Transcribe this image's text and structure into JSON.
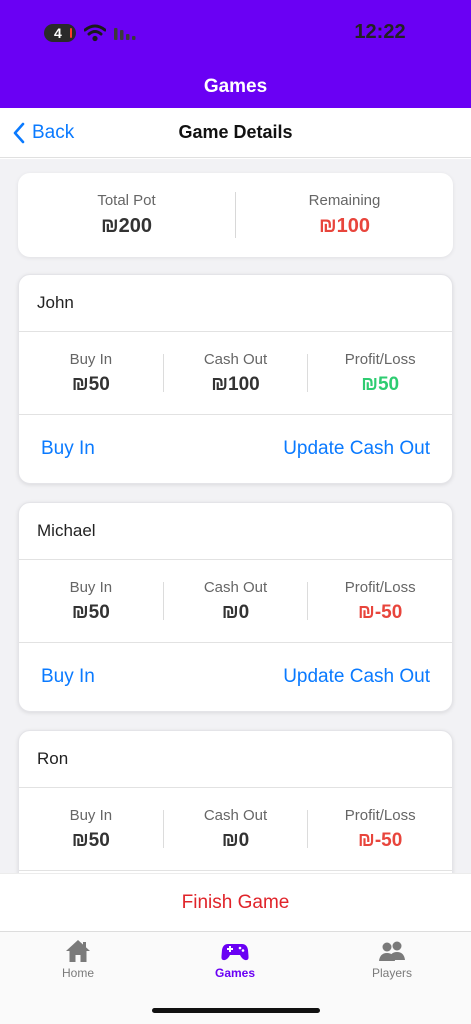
{
  "status_bar": {
    "badge": "4",
    "time": "12:22"
  },
  "header": {
    "title": "Games"
  },
  "navbar": {
    "back_label": "Back",
    "title": "Game Details"
  },
  "summary": {
    "total_pot_label": "Total Pot",
    "total_pot_value": "₪200",
    "remaining_label": "Remaining",
    "remaining_value": "₪100"
  },
  "stat_labels": {
    "buy_in": "Buy In",
    "cash_out": "Cash Out",
    "profit_loss": "Profit/Loss"
  },
  "actions": {
    "buy_in": "Buy In",
    "update_cash_out": "Update Cash Out"
  },
  "players": [
    {
      "name": "John",
      "buy_in": "₪50",
      "cash_out": "₪100",
      "profit_loss": "₪50"
    },
    {
      "name": "Michael",
      "buy_in": "₪50",
      "cash_out": "₪0",
      "profit_loss": "₪-50"
    },
    {
      "name": "Ron",
      "buy_in": "₪50",
      "cash_out": "₪0",
      "profit_loss": "₪-50"
    }
  ],
  "finish_label": "Finish Game",
  "tabs": [
    {
      "label": "Home",
      "icon": "home-icon"
    },
    {
      "label": "Games",
      "icon": "gamepad-icon"
    },
    {
      "label": "Players",
      "icon": "people-icon"
    }
  ],
  "colors": {
    "brand": "#6a00f4",
    "link": "#0a7aff",
    "negative": "#e8453c",
    "positive": "#2ecc71",
    "danger": "#e0242a"
  }
}
